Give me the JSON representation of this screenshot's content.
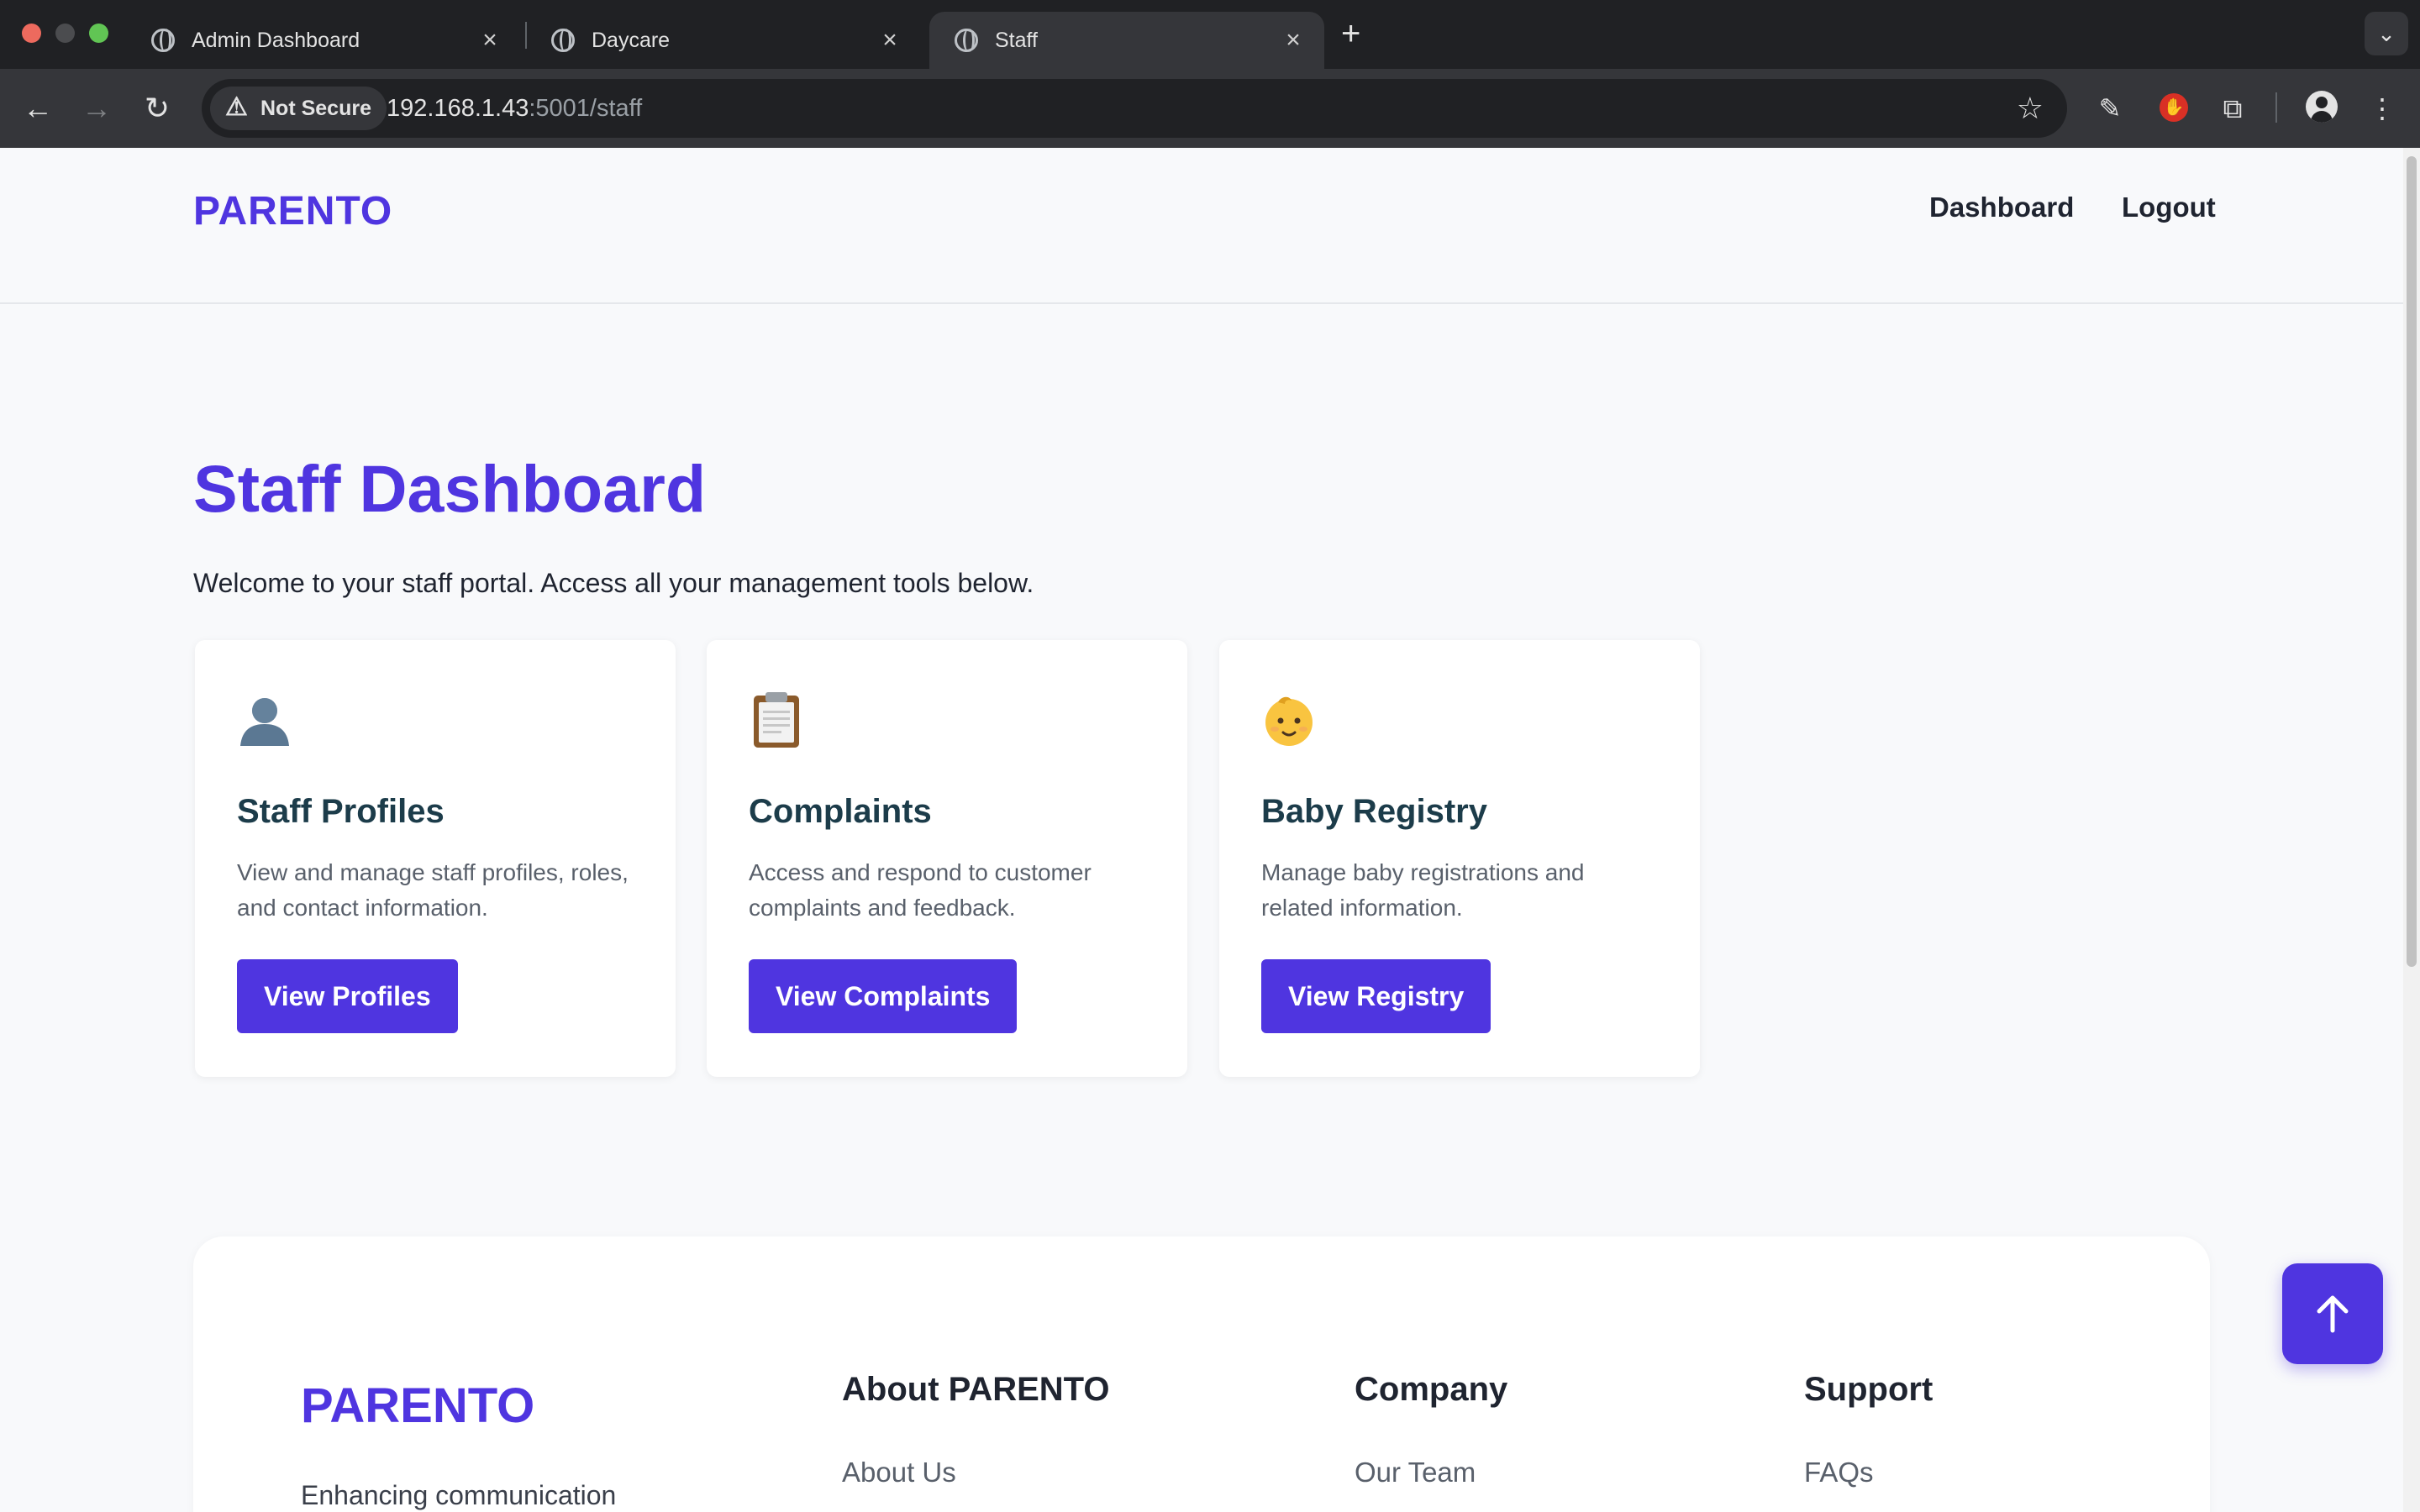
{
  "browser": {
    "tabs": [
      {
        "title": "Admin Dashboard",
        "active": false
      },
      {
        "title": "Daycare",
        "active": false
      },
      {
        "title": "Staff",
        "active": true
      }
    ],
    "security_label": "Not Secure",
    "url_host": "192.168.1.43",
    "url_path": ":5001/staff"
  },
  "header": {
    "brand": "PARENTO",
    "nav": [
      "Dashboard",
      "Logout"
    ]
  },
  "main": {
    "title": "Staff Dashboard",
    "welcome": "Welcome to your staff portal. Access all your management tools below.",
    "cards": [
      {
        "icon": "person-silhouette-icon",
        "title": "Staff Profiles",
        "description": "View and manage staff profiles, roles, and contact information.",
        "button": "View Profiles"
      },
      {
        "icon": "clipboard-icon",
        "title": "Complaints",
        "description": "Access and respond to customer complaints and feedback.",
        "button": "View Complaints"
      },
      {
        "icon": "baby-icon",
        "title": "Baby Registry",
        "description": "Manage baby registrations and related information.",
        "button": "View Registry"
      }
    ]
  },
  "footer": {
    "brand": "PARENTO",
    "tagline": "Enhancing communication",
    "columns": [
      {
        "heading": "About PARENTO",
        "first_link": "About Us"
      },
      {
        "heading": "Company",
        "first_link": "Our Team"
      },
      {
        "heading": "Support",
        "first_link": "FAQs"
      }
    ]
  },
  "colors": {
    "accent": "#4f35e0",
    "card_title": "#1c3c4a",
    "page_background": "#f8f9fb"
  }
}
